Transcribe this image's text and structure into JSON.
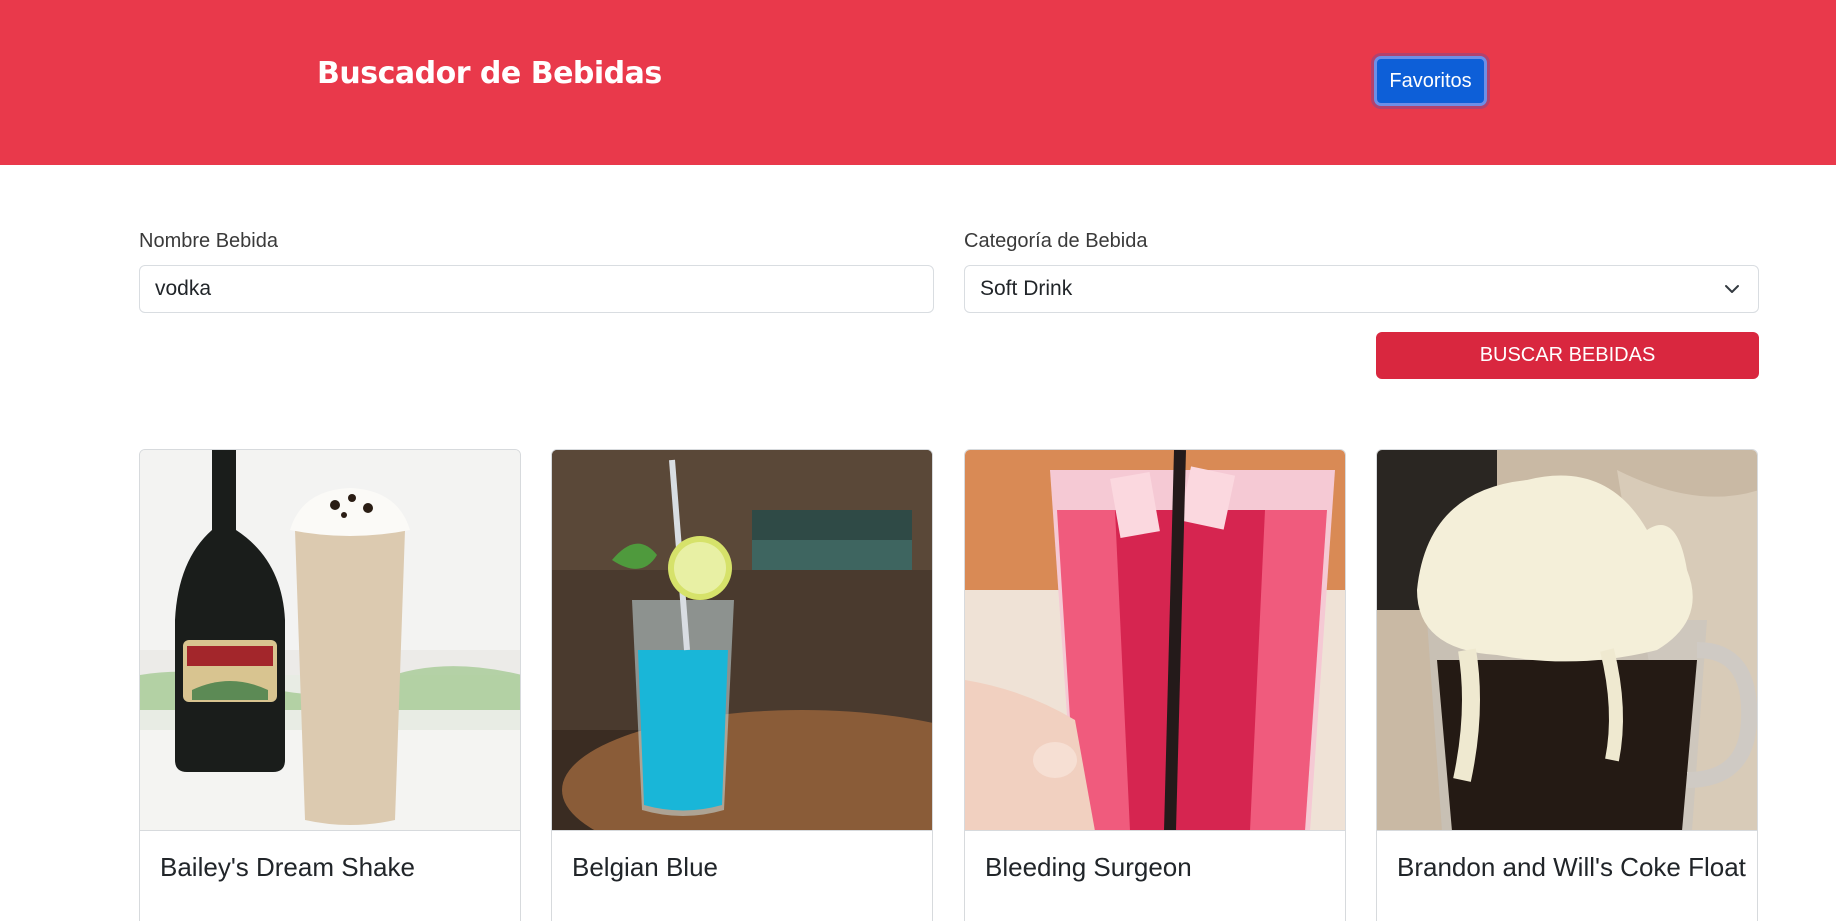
{
  "header": {
    "title": "Buscador de Bebidas",
    "favorites_label": "Favoritos",
    "bg_color": "#e9394b"
  },
  "form": {
    "name_label": "Nombre Bebida",
    "name_value": "vodka",
    "category_label": "Categoría de Bebida",
    "category_value": "Soft Drink",
    "submit_label": "BUSCAR BEBIDAS"
  },
  "drinks": [
    {
      "name": "Bailey's Dream Shake",
      "photo": "milkshake-photo"
    },
    {
      "name": "Belgian Blue",
      "photo": "blue-cocktail-photo"
    },
    {
      "name": "Bleeding Surgeon",
      "photo": "red-drink-photo"
    },
    {
      "name": "Brandon and Will's Coke Float",
      "photo": "coke-float-photo"
    }
  ]
}
